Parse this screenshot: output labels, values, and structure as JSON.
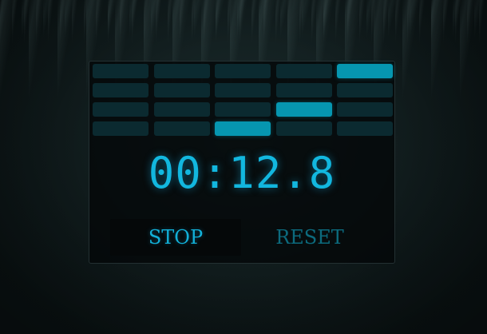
{
  "stopwatch": {
    "time_display": "00:12.8",
    "grid": {
      "rows": 4,
      "cols": 5,
      "active_cells": [
        [
          0,
          4
        ],
        [
          2,
          3
        ],
        [
          3,
          2
        ]
      ]
    },
    "stop_label": "STOP",
    "reset_label": "RESET"
  },
  "colors": {
    "accent": "#12b7df",
    "cell_active": "#0696b0",
    "cell_inactive": "#0b2a30",
    "reset_text": "#0c6a7d"
  }
}
